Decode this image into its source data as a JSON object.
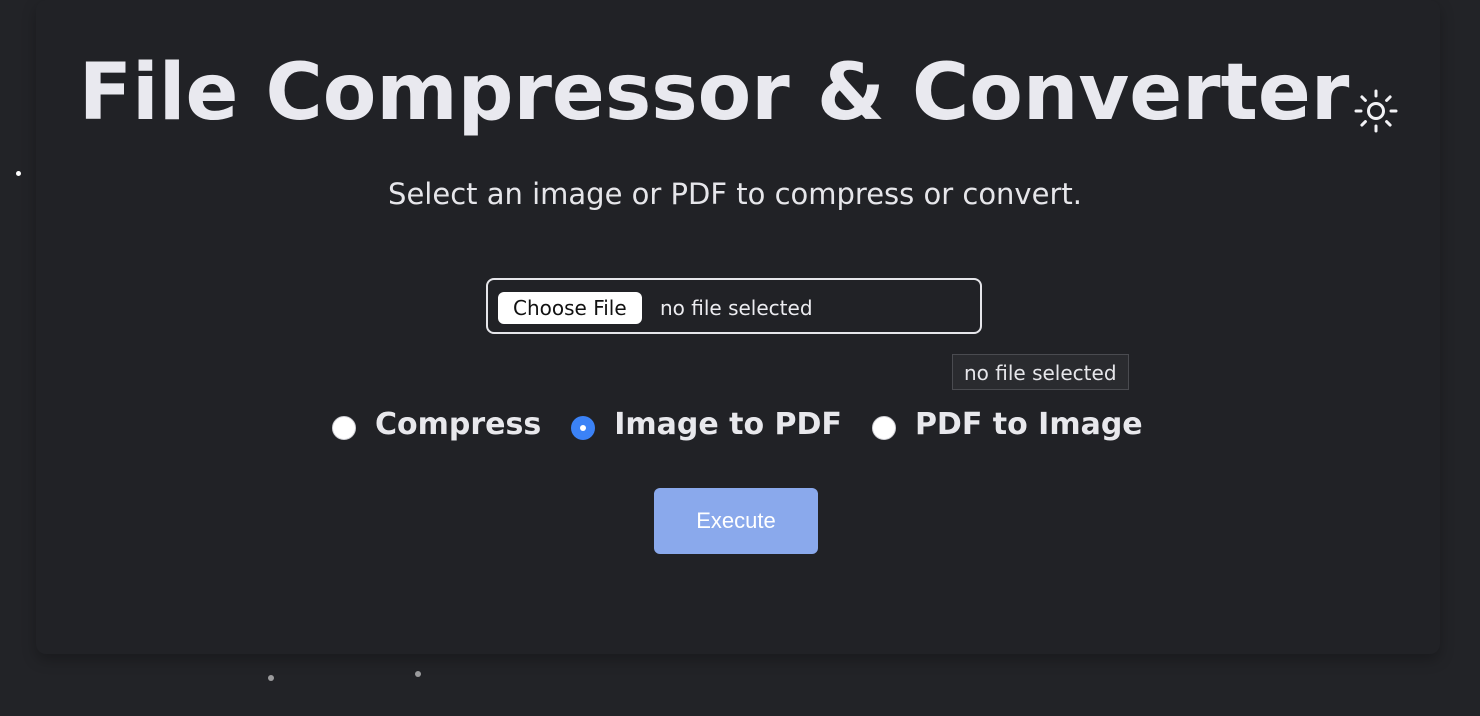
{
  "header": {
    "title": "File Compressor & Converter",
    "theme_icon": "sun-icon"
  },
  "subtitle": "Select an image or PDF to compress or convert.",
  "file_input": {
    "button_label": "Choose File",
    "status": "no file selected",
    "tooltip": "no file selected"
  },
  "modes": [
    {
      "label": "Compress",
      "selected": false
    },
    {
      "label": "Image to PDF",
      "selected": true
    },
    {
      "label": "PDF to Image",
      "selected": false
    }
  ],
  "execute_label": "Execute",
  "colors": {
    "background": "#222327",
    "accent": "#3b82f6",
    "execute_button": "#8aa9ec"
  }
}
